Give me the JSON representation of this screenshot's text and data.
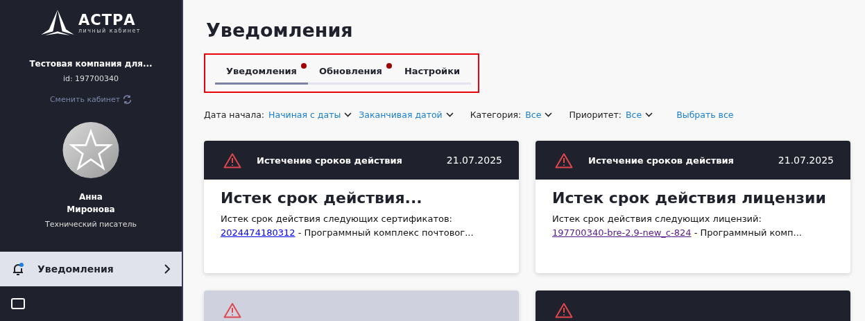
{
  "sidebar": {
    "logo": {
      "name": "АСТРА",
      "subtitle": "личный кабинет"
    },
    "company": "Тестовая компания для...",
    "company_id": "id: 197700340",
    "switch_link": "Сменить кабинет",
    "user": {
      "first_name": "Анна",
      "last_name": "Миронова",
      "role": "Технический писатель"
    },
    "nav": [
      {
        "label": "Уведомления",
        "selected": true,
        "badge": true
      },
      {
        "selected": false
      }
    ]
  },
  "page_title": "Уведомления",
  "tabs": [
    {
      "label": "Уведомления",
      "selected": true,
      "dot": true
    },
    {
      "label": "Обновления",
      "selected": false,
      "dot": true
    },
    {
      "label": "Настройки",
      "selected": false,
      "dot": false
    }
  ],
  "filters": [
    {
      "kind": "label",
      "text": "Дата начала:"
    },
    {
      "kind": "dropdown",
      "text": "Начиная с даты"
    },
    {
      "kind": "dropdown",
      "text": "Заканчивая датой"
    },
    {
      "kind": "label",
      "text": "Категория:"
    },
    {
      "kind": "dropdown",
      "text": "Все"
    },
    {
      "kind": "label",
      "text": "Приоритет:"
    },
    {
      "kind": "dropdown",
      "text": "Все"
    },
    {
      "kind": "link",
      "text": "Выбрать все"
    }
  ],
  "cards": [
    {
      "read": false,
      "category": "Истечение сроков действия",
      "date": "21.07.2025",
      "title": "Истек срок действия...",
      "body": "Истек срок действия следующих сертификатов:",
      "link": "2024474180312",
      "link_visited": false,
      "rest": " - Программный комплекс почтовог..."
    },
    {
      "read": false,
      "category": "Истечение сроков действия",
      "date": "21.07.2025",
      "title": "Истек срок действия лицензии",
      "body": "Истек срок действия следующих лицензий:",
      "link": "197700340-bre-2.9-new_c-824",
      "link_visited": true,
      "rest": " - Программный комп..."
    },
    {
      "read": true
    },
    {
      "read": false
    }
  ]
}
